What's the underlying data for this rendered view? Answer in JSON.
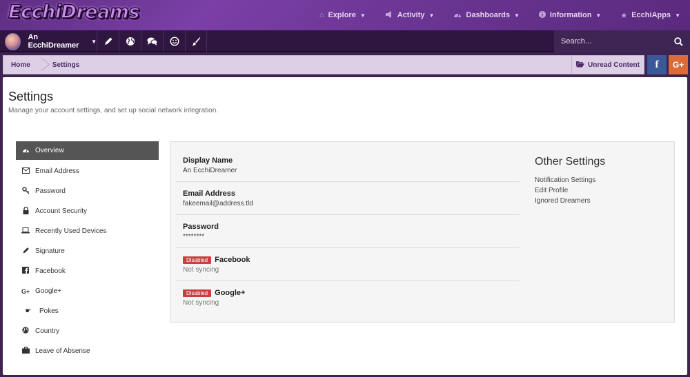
{
  "site": {
    "logo": "EcchiDreams"
  },
  "nav": {
    "items": [
      {
        "label": "Explore",
        "icon": "home-icon"
      },
      {
        "label": "Activity",
        "icon": "megaphone-icon"
      },
      {
        "label": "Dashboards",
        "icon": "dashboard-icon"
      },
      {
        "label": "Information",
        "icon": "info-icon"
      },
      {
        "label": "EcchiApps",
        "icon": "star-icon"
      }
    ]
  },
  "userbar": {
    "username": "An EcchiDreamer",
    "icons": [
      "pencil-icon",
      "globe-icon",
      "chat-icon",
      "smile-icon",
      "brush-icon"
    ],
    "search_placeholder": "Search..."
  },
  "breadcrumb": {
    "home": "Home",
    "current": "Settings",
    "unread": "Unread Content"
  },
  "social": {
    "facebook": "f",
    "googleplus": "G+"
  },
  "page": {
    "title": "Settings",
    "subtitle": "Manage your account settings, and set up social network integration."
  },
  "sidebar": {
    "items": [
      {
        "label": "Overview",
        "icon": "dashboard-icon",
        "active": true
      },
      {
        "label": "Email Address",
        "icon": "envelope-icon"
      },
      {
        "label": "Password",
        "icon": "key-icon"
      },
      {
        "label": "Account Security",
        "icon": "lock-icon"
      },
      {
        "label": "Recently Used Devices",
        "icon": "laptop-icon"
      },
      {
        "label": "Signature",
        "icon": "pencil-icon"
      },
      {
        "label": "Facebook",
        "icon": "facebook-icon"
      },
      {
        "label": "Google+",
        "icon": "googleplus-icon"
      },
      {
        "label": "Pokes",
        "icon": "hand-pointer-icon"
      },
      {
        "label": "Country",
        "icon": "globe-icon"
      },
      {
        "label": "Leave of Absense",
        "icon": "briefcase-icon"
      }
    ]
  },
  "overview": {
    "display_name": {
      "label": "Display Name",
      "value": "An EcchiDreamer"
    },
    "email": {
      "label": "Email Address",
      "value": "fakeemail@address.tld"
    },
    "password": {
      "label": "Password",
      "value": "********"
    },
    "facebook": {
      "badge": "Disabled",
      "label": "Facebook",
      "status": "Not syncing"
    },
    "googleplus": {
      "badge": "Disabled",
      "label": "Google+",
      "status": "Not syncing"
    }
  },
  "other_settings": {
    "title": "Other Settings",
    "links": [
      "Notification Settings",
      "Edit Profile",
      "Ignored Dreamers"
    ]
  },
  "colors": {
    "header_purple": "#6b3593",
    "userbar": "#2e1640",
    "breadcrumb_bg": "#ddd0e6",
    "facebook": "#3b5998",
    "googleplus": "#dd6a38",
    "disabled_badge": "#c94040",
    "active_sidebar": "#555555"
  }
}
